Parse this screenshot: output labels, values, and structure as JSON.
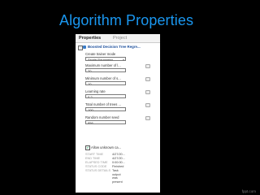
{
  "slide": {
    "title": "Algorithm Properties",
    "watermark": "fppt.com"
  },
  "panel": {
    "tabs": [
      "Properties",
      "Project"
    ],
    "module_title": "Boosted Decision Tree Regre...",
    "fields": [
      {
        "label": "Create trainer mode",
        "value": "Single Parameter",
        "type": "select"
      },
      {
        "label": "Maximum number of l...",
        "value": "20",
        "type": "text"
      },
      {
        "label": "Minimum number of s...",
        "value": "10",
        "type": "text"
      },
      {
        "label": "Learning rate",
        "value": "0.2",
        "type": "text"
      },
      {
        "label": "Total number of trees ...",
        "value": "100",
        "type": "text"
      },
      {
        "label": "Random number seed",
        "value": "856",
        "type": "text"
      }
    ],
    "allow_unknown": {
      "label": "Allow unknown ca...",
      "checked": true,
      "check_glyph": "✔"
    },
    "status": [
      {
        "label": "START TIME",
        "value": "4/27/20..."
      },
      {
        "label": "END TIME",
        "value": "4/27/20..."
      },
      {
        "label": "ELAPSED TIME",
        "value": "0:00:00..."
      },
      {
        "label": "STATUS CODE",
        "value": "Finished"
      },
      {
        "label": "STATUS DETAILS",
        "value": "Task"
      },
      {
        "label": "",
        "value": "output"
      },
      {
        "label": "",
        "value": "was"
      },
      {
        "label": "",
        "value": "present"
      }
    ]
  }
}
